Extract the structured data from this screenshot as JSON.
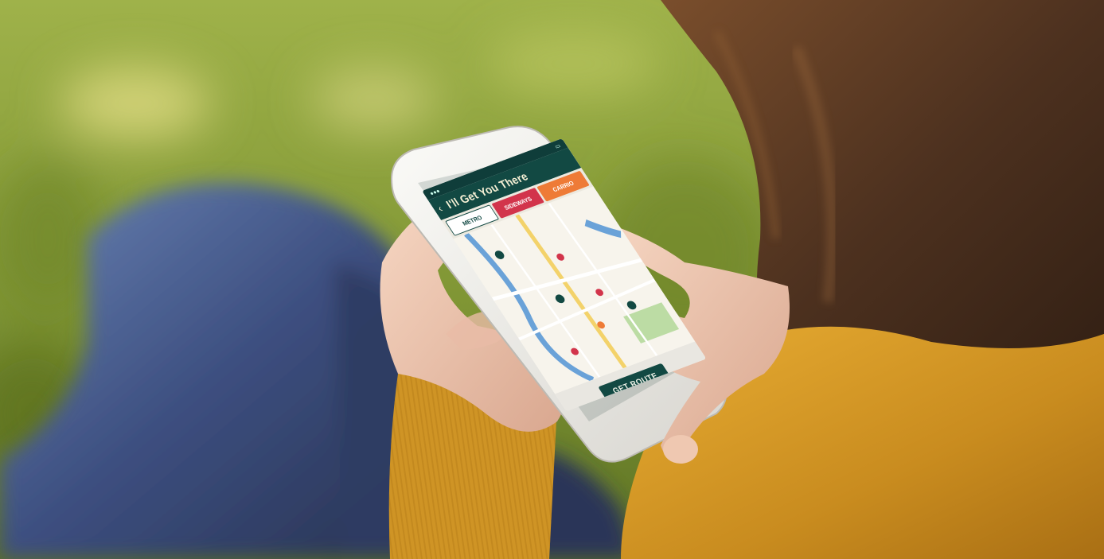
{
  "photo": {
    "phone_app": {
      "header": {
        "title": "I'll Get You There"
      },
      "tabs": [
        {
          "label": "METRO"
        },
        {
          "label": "SIDEWAYS"
        },
        {
          "label": "CARRIO"
        }
      ],
      "cta_label": "GET ROUTE",
      "map_icons": [
        "metro-pin-icon",
        "parking-pin-icon",
        "food-pin-icon"
      ]
    },
    "palette": {
      "grass": "#8fa43a",
      "jeans": "#3b4a78",
      "sweater": "#d69a25",
      "hair": "#5b3a22",
      "app_teal": "#124943",
      "tab_red": "#d2344b",
      "tab_orange": "#ee7b37"
    }
  }
}
